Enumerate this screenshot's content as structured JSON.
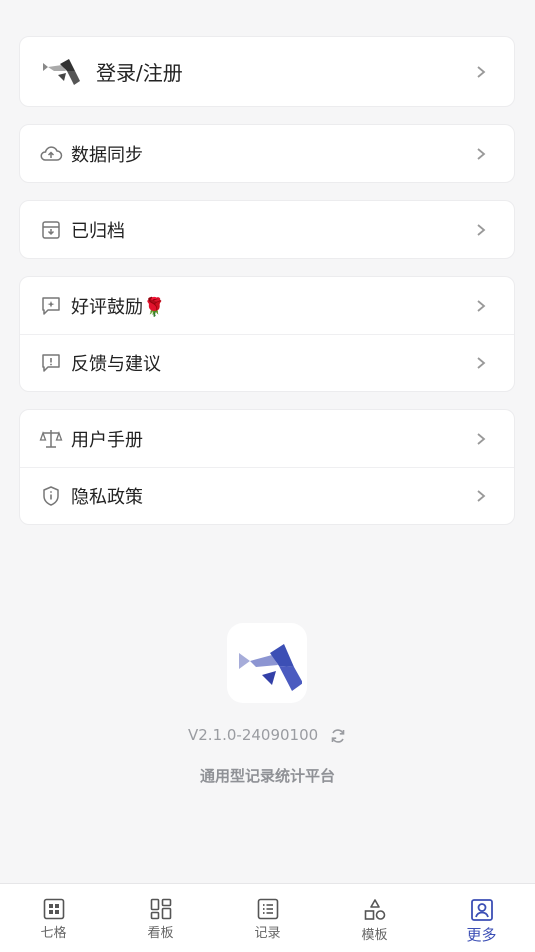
{
  "login": {
    "label": "登录/注册",
    "logo_icon": "fish-logo-icon"
  },
  "menu": {
    "sync": {
      "label": "数据同步",
      "icon": "cloud-upload-icon"
    },
    "archived": {
      "label": "已归档",
      "icon": "archive-box-icon"
    },
    "rate": {
      "label": "好评鼓励🌹",
      "icon": "chat-star-icon"
    },
    "feedback": {
      "label": "反馈与建议",
      "icon": "chat-alert-icon"
    },
    "manual": {
      "label": "用户手册",
      "icon": "scale-icon"
    },
    "privacy": {
      "label": "隐私政策",
      "icon": "shield-info-icon"
    }
  },
  "about": {
    "version": "V2.1.0-24090100",
    "tagline": "通用型记录统计平台"
  },
  "tabs": [
    {
      "label": "七格",
      "icon": "grid-icon"
    },
    {
      "label": "看板",
      "icon": "dashboard-icon"
    },
    {
      "label": "记录",
      "icon": "list-icon"
    },
    {
      "label": "模板",
      "icon": "shapes-icon"
    },
    {
      "label": "更多",
      "icon": "profile-icon"
    }
  ],
  "colors": {
    "accent": "#3c4fb5",
    "background": "#f6f6f7"
  }
}
